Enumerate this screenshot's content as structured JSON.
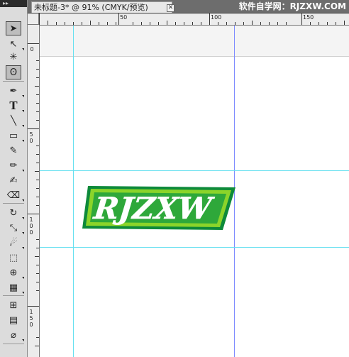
{
  "document": {
    "tab_title": "未标题-3* @ 91% (CMYK/预览)",
    "close_glyph": "✕"
  },
  "watermark": "软件自学网：RJZXW.COM",
  "toolbox_header": "▸▸",
  "ruler": {
    "top_labels": [
      "50",
      "100",
      "150"
    ],
    "left_labels": [
      "0",
      "50",
      "100",
      "150"
    ]
  },
  "canvas": {
    "logo_text": "RJZXW",
    "colors": {
      "outer_border": "#0d8a3a",
      "inner_band": "#8bd42a",
      "fill": "#2ea83a",
      "text": "#ffffff",
      "guide": "#66e0f0"
    }
  },
  "tools": [
    {
      "name": "selection-tool-icon",
      "glyph": "➤"
    },
    {
      "name": "direct-selection-tool-icon",
      "glyph": "↖"
    },
    {
      "name": "magic-wand-tool-icon",
      "glyph": "✳"
    },
    {
      "name": "lasso-tool-icon",
      "glyph": "ʘ"
    },
    {
      "name": "pen-tool-icon",
      "glyph": "✒"
    },
    {
      "name": "type-tool-icon",
      "glyph": "T"
    },
    {
      "name": "line-segment-tool-icon",
      "glyph": "╲"
    },
    {
      "name": "rectangle-tool-icon",
      "glyph": "▭"
    },
    {
      "name": "paintbrush-tool-icon",
      "glyph": "✎"
    },
    {
      "name": "pencil-tool-icon",
      "glyph": "✏"
    },
    {
      "name": "blob-brush-tool-icon",
      "glyph": "✍"
    },
    {
      "name": "eraser-tool-icon",
      "glyph": "⌫"
    },
    {
      "name": "rotate-tool-icon",
      "glyph": "↻"
    },
    {
      "name": "scale-tool-icon",
      "glyph": "⤡"
    },
    {
      "name": "warp-tool-icon",
      "glyph": "☄"
    },
    {
      "name": "free-transform-tool-icon",
      "glyph": "⬚"
    },
    {
      "name": "shape-builder-tool-icon",
      "glyph": "⊕"
    },
    {
      "name": "perspective-grid-tool-icon",
      "glyph": "▦"
    },
    {
      "name": "mesh-tool-icon",
      "glyph": "⊞"
    },
    {
      "name": "gradient-tool-icon",
      "glyph": "▤"
    },
    {
      "name": "eyedropper-tool-icon",
      "glyph": "⌀"
    }
  ]
}
